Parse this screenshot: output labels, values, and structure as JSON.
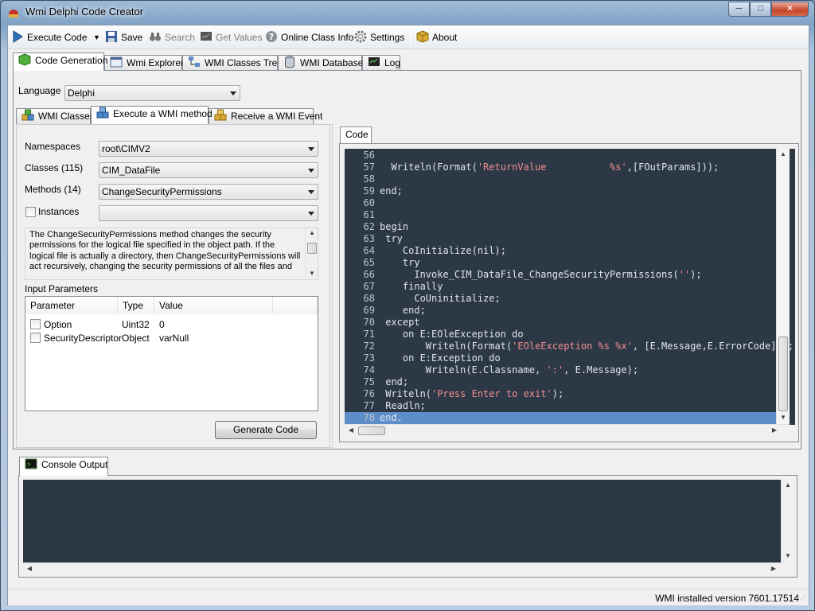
{
  "window": {
    "title": "Wmi Delphi Code Creator"
  },
  "toolbar": {
    "execute": "Execute Code",
    "save": "Save",
    "search": "Search",
    "get_values": "Get Values",
    "online_class_info": "Online Class Info",
    "settings": "Settings",
    "about": "About"
  },
  "main_tabs": [
    "Code Generation",
    "Wmi Explorer",
    "WMI Classes Tree",
    "WMI Database",
    "Log"
  ],
  "language": {
    "label": "Language",
    "value": "Delphi"
  },
  "sub_tabs": [
    "WMI Classes",
    "Execute a WMI method",
    "Receive a WMI Event"
  ],
  "form": {
    "namespaces_label": "Namespaces",
    "namespaces_value": "root\\CIMV2",
    "classes_label": "Classes (115)",
    "classes_value": "CIM_DataFile",
    "methods_label": "Methods (14)",
    "methods_value": "ChangeSecurityPermissions",
    "instances_label": "Instances",
    "instances_value": "",
    "description_lines": [
      "The ChangeSecurityPermissions method changes the security",
      "permissions for the logical file specified in the object path. If the",
      "logical file is actually a directory, then ChangeSecurityPermissions will",
      "act recursively, changing the security permissions of all the files and"
    ],
    "input_params_label": "Input Parameters",
    "columns": [
      "Parameter",
      "Type",
      "Value"
    ],
    "params": [
      {
        "name": "Option",
        "type": "Uint32",
        "value": "0"
      },
      {
        "name": "SecurityDescriptor",
        "type": "Object",
        "value": "varNull"
      }
    ],
    "generate_button": "Generate Code"
  },
  "code_tab": "Code",
  "code_lines": [
    {
      "n": "56",
      "t": ""
    },
    {
      "n": "57",
      "t": "  Writeln(Format('ReturnValue           %s',[FOutParams]));"
    },
    {
      "n": "58",
      "t": ""
    },
    {
      "n": "59",
      "t": "end;"
    },
    {
      "n": "60",
      "t": ""
    },
    {
      "n": "61",
      "t": ""
    },
    {
      "n": "62",
      "t": "begin"
    },
    {
      "n": "63",
      "t": " try"
    },
    {
      "n": "64",
      "t": "    CoInitialize(nil);"
    },
    {
      "n": "65",
      "t": "    try"
    },
    {
      "n": "66",
      "t": "      Invoke_CIM_DataFile_ChangeSecurityPermissions('');"
    },
    {
      "n": "67",
      "t": "    finally"
    },
    {
      "n": "68",
      "t": "      CoUninitialize;"
    },
    {
      "n": "69",
      "t": "    end;"
    },
    {
      "n": "70",
      "t": " except"
    },
    {
      "n": "71",
      "t": "    on E:EOleException do"
    },
    {
      "n": "72",
      "t": "        Writeln(Format('EOleException %s %x', [E.Message,E.ErrorCode]));"
    },
    {
      "n": "73",
      "t": "    on E:Exception do"
    },
    {
      "n": "74",
      "t": "        Writeln(E.Classname, ':', E.Message);"
    },
    {
      "n": "75",
      "t": " end;"
    },
    {
      "n": "76",
      "t": " Writeln('Press Enter to exit');"
    },
    {
      "n": "77",
      "t": " Readln;"
    },
    {
      "n": "78",
      "t": "end."
    }
  ],
  "console_tab": "Console Output",
  "status": {
    "text": "WMI installed version 7601.17514"
  },
  "colors": {
    "editor_bg": "#2c3845",
    "string_color": "#f08f8f",
    "selection": "#5d8ec9"
  }
}
